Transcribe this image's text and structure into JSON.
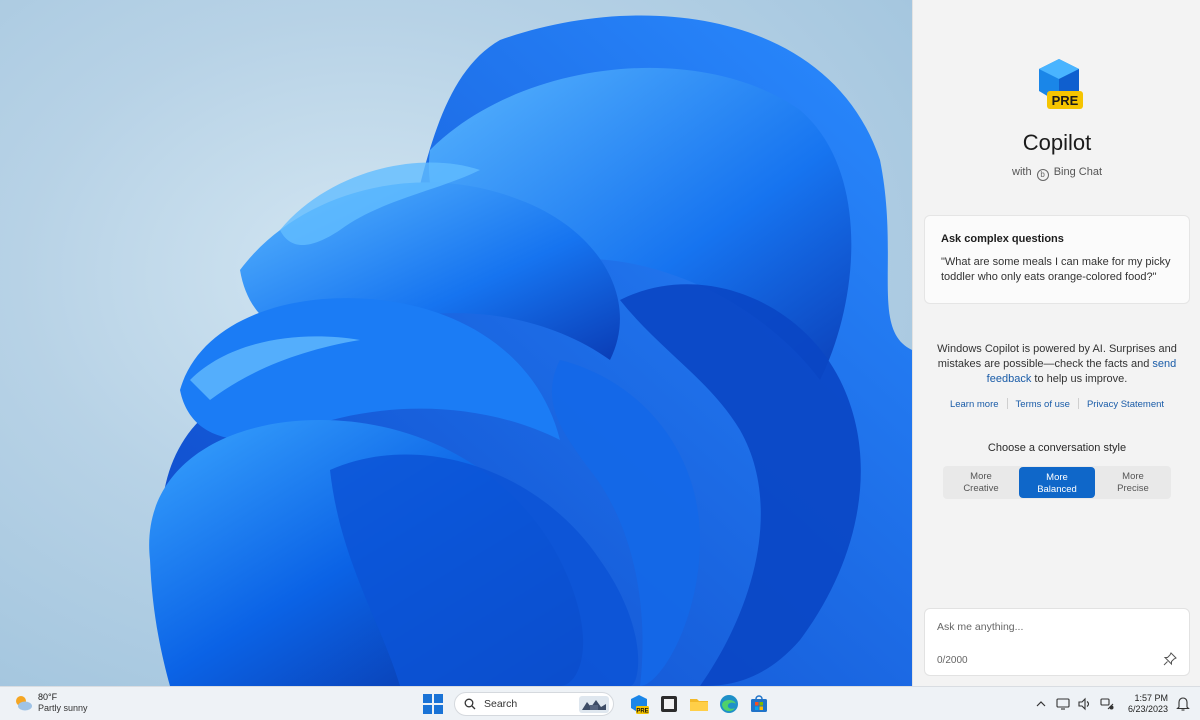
{
  "copilot": {
    "title": "Copilot",
    "badge": "PRE",
    "subtitle_prefix": "with",
    "subtitle_brand": "Bing Chat",
    "card": {
      "heading": "Ask complex questions",
      "question": "\"What are some meals I can make for my picky toddler who only eats orange-colored food?\""
    },
    "disclaimer": {
      "text_before": "Windows Copilot is powered by AI. Surprises and mistakes are possible—check the facts and ",
      "link1": "send",
      "link2": "feedback",
      "text_after": " to help us improve."
    },
    "links": [
      "Learn more",
      "Terms of use",
      "Privacy Statement"
    ],
    "style_label": "Choose a conversation style",
    "styles": [
      {
        "line1": "More",
        "line2": "Creative"
      },
      {
        "line1": "More",
        "line2": "Balanced"
      },
      {
        "line1": "More",
        "line2": "Precise"
      }
    ],
    "selected_style": "Balanced",
    "input": {
      "placeholder": "Ask me anything...",
      "counter": "0/2000"
    }
  },
  "taskbar": {
    "weather": {
      "temp": "80°F",
      "condition": "Partly sunny"
    },
    "search_label": "Search",
    "apps": [
      "copilot-icon",
      "file-explorer-icon",
      "folder-icon",
      "edge-icon",
      "store-icon"
    ],
    "clock": {
      "time": "1:57 PM",
      "date": "6/23/2023"
    }
  },
  "colors": {
    "accent": "#0f67c9",
    "link": "#1a5ca8",
    "pane_bg": "#f3f3f3",
    "taskbar_bg": "#eef2f6"
  }
}
